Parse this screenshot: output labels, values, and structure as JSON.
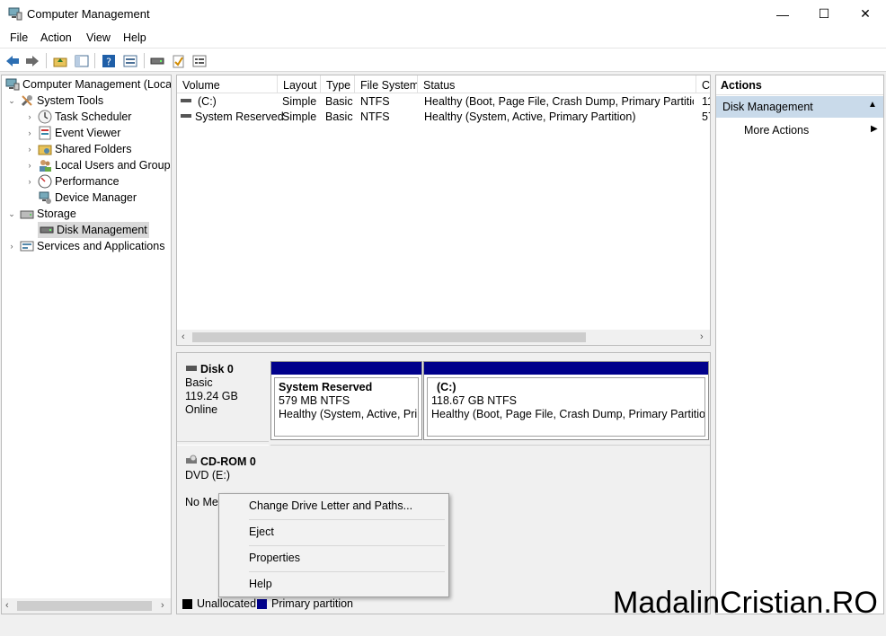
{
  "window": {
    "title": "Computer Management",
    "minimize": "—",
    "maximize": "☐",
    "close": "✕"
  },
  "menu": [
    "File",
    "Action",
    "View",
    "Help"
  ],
  "toolbar_icons": [
    "back-icon",
    "forward-icon",
    "up-folder-icon",
    "show-hide-tree-icon",
    "help-icon",
    "properties-icon",
    "disk-icon",
    "check-icon",
    "list-icon"
  ],
  "tree": {
    "root": "Computer Management (Local",
    "system_tools": "System Tools",
    "task_scheduler": "Task Scheduler",
    "event_viewer": "Event Viewer",
    "shared_folders": "Shared Folders",
    "local_users": "Local Users and Groups",
    "performance": "Performance",
    "device_manager": "Device Manager",
    "storage": "Storage",
    "disk_management": "Disk Management",
    "services": "Services and Applications"
  },
  "volumes": {
    "columns": [
      "Volume",
      "Layout",
      "Type",
      "File System",
      "Status",
      "C"
    ],
    "rows": [
      {
        "volume": "(C:)",
        "layout": "Simple",
        "type": "Basic",
        "fs": "NTFS",
        "status": "Healthy (Boot, Page File, Crash Dump, Primary Partition)",
        "cap": "11"
      },
      {
        "volume": "System Reserved",
        "layout": "Simple",
        "type": "Basic",
        "fs": "NTFS",
        "status": "Healthy (System, Active, Primary Partition)",
        "cap": "57"
      }
    ]
  },
  "disks": {
    "disk0": {
      "name": "Disk 0",
      "kind": "Basic",
      "size": "119.24 GB",
      "state": "Online"
    },
    "part_reserved": {
      "name": "System Reserved",
      "size": "579 MB NTFS",
      "status": "Healthy (System, Active, Prim"
    },
    "part_c": {
      "name": "(C:)",
      "size": "118.67 GB NTFS",
      "status": "Healthy (Boot, Page File, Crash Dump, Primary Partition)"
    },
    "cdrom": {
      "name": "CD-ROM 0",
      "drive": "DVD (E:)",
      "media": "No Me"
    }
  },
  "legend": {
    "unallocated": "Unallocated",
    "primary": "Primary partition",
    "unallocated_color": "#000000",
    "primary_color": "#00008b"
  },
  "actions": {
    "header": "Actions",
    "section": "Disk Management",
    "more": "More Actions"
  },
  "context_menu": [
    "Change Drive Letter and Paths...",
    "Eject",
    "Properties",
    "Help"
  ],
  "watermark": "MadalinCristian.RO"
}
